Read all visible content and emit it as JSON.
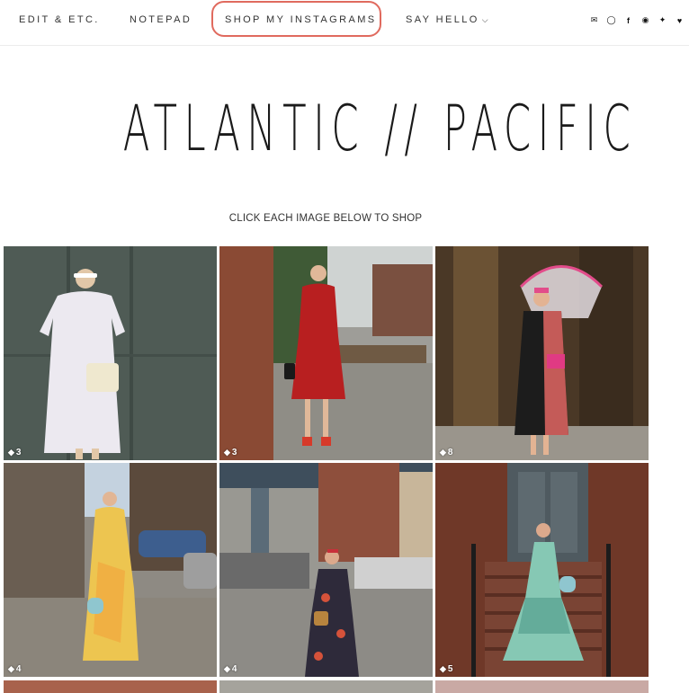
{
  "nav": {
    "items": [
      {
        "label": "EDIT & ETC."
      },
      {
        "label": "NOTEPAD"
      },
      {
        "label": "SHOP MY INSTAGRAMS"
      },
      {
        "label": "SAY HELLO"
      }
    ],
    "social_icons": [
      "mail-icon",
      "instagram-icon",
      "facebook-icon",
      "pinterest-icon",
      "twitter-icon",
      "heart-icon"
    ]
  },
  "brand": {
    "title": "ATLANTIC // PACIFIC"
  },
  "page": {
    "subtitle": "CLICK EACH IMAGE BELOW TO SHOP"
  },
  "grid": {
    "tiles": [
      {
        "count": "3",
        "bg": "#4b5650",
        "figure": "#e8e6ee"
      },
      {
        "count": "3",
        "bg": "#7d5a4a",
        "figure": "#b8201f"
      },
      {
        "count": "8",
        "bg": "#5a4530",
        "figure": "#1c1c1c"
      },
      {
        "count": "4",
        "bg": "#8d8a84",
        "figure": "#e9c449"
      },
      {
        "count": "4",
        "bg": "#8f8e8a",
        "figure": "#2a2a3a"
      },
      {
        "count": "5",
        "bg": "#6d3a2a",
        "figure": "#7fc7b5"
      }
    ]
  }
}
